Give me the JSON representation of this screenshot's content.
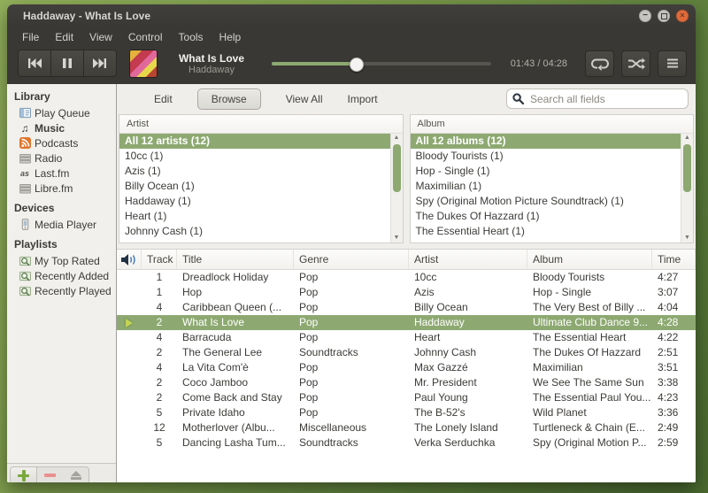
{
  "window": {
    "title": "Haddaway - What Is Love",
    "buttons": [
      {
        "icon": "minimize-icon"
      },
      {
        "icon": "maximize-icon"
      },
      {
        "icon": "close-icon"
      }
    ]
  },
  "menu": {
    "items": [
      "File",
      "Edit",
      "View",
      "Control",
      "Tools",
      "Help"
    ]
  },
  "player": {
    "transport": [
      {
        "icon": "previous-icon"
      },
      {
        "icon": "pause-icon"
      },
      {
        "icon": "next-icon"
      }
    ],
    "track_title": "What Is Love",
    "track_artist": "Haddaway",
    "time": "01:43 / 04:28",
    "progress_percent": 38.5,
    "extra_buttons": [
      {
        "icon": "repeat-icon"
      },
      {
        "icon": "shuffle-icon"
      },
      {
        "icon": "menu-icon"
      }
    ]
  },
  "sidebar": {
    "sections": [
      {
        "label": "Library",
        "items": [
          {
            "label": "Play Queue",
            "icon": "play-queue-icon"
          },
          {
            "label": "Music",
            "icon": "music-note-icon",
            "selected": true
          },
          {
            "label": "Podcasts",
            "icon": "rss-icon"
          },
          {
            "label": "Radio",
            "icon": "stack-icon"
          },
          {
            "label": "Last.fm",
            "icon": "lastfm-icon"
          },
          {
            "label": "Libre.fm",
            "icon": "stack-icon"
          }
        ]
      },
      {
        "label": "Devices",
        "items": [
          {
            "label": "Media Player",
            "icon": "device-icon"
          }
        ]
      },
      {
        "label": "Playlists",
        "items": [
          {
            "label": "My Top Rated",
            "icon": "smart-playlist-icon"
          },
          {
            "label": "Recently Added",
            "icon": "smart-playlist-icon"
          },
          {
            "label": "Recently Played",
            "icon": "smart-playlist-icon"
          }
        ]
      }
    ],
    "footer_buttons": [
      {
        "icon": "add-icon",
        "active": true
      },
      {
        "icon": "remove-icon"
      },
      {
        "icon": "eject-icon"
      }
    ]
  },
  "toolbar": {
    "tabs": [
      "Edit",
      "Browse",
      "View All",
      "Import"
    ],
    "active_tab": "Browse",
    "search_icon": "search-icon",
    "search_placeholder": "Search all fields",
    "search_value": ""
  },
  "browser": {
    "artist": {
      "header": "Artist",
      "selected": "All 12 artists (12)",
      "items": [
        "10cc (1)",
        "Azis (1)",
        "Billy Ocean (1)",
        "Haddaway (1)",
        "Heart (1)",
        "Johnny Cash (1)"
      ]
    },
    "album": {
      "header": "Album",
      "selected": "All 12 albums (12)",
      "items": [
        "Bloody Tourists (1)",
        "Hop - Single (1)",
        "Maximilian (1)",
        "Spy (Original Motion Picture Soundtrack) (1)",
        "The Dukes Of Hazzard (1)",
        "The Essential Heart (1)"
      ]
    }
  },
  "tracklist": {
    "header_icon": "speaker-icon",
    "columns": [
      "Track",
      "Title",
      "Genre",
      "Artist",
      "Album",
      "Time"
    ],
    "rows": [
      {
        "track": "1",
        "title": "Dreadlock Holiday",
        "genre": "Pop",
        "artist": "10cc",
        "album": "Bloody Tourists",
        "time": "4:27"
      },
      {
        "track": "1",
        "title": "Hop",
        "genre": "Pop",
        "artist": "Azis",
        "album": "Hop - Single",
        "time": "3:07"
      },
      {
        "track": "4",
        "title": "Caribbean Queen (...",
        "genre": "Pop",
        "artist": "Billy Ocean",
        "album": "The Very Best of Billy ...",
        "time": "4:04"
      },
      {
        "track": "2",
        "title": "What Is Love",
        "genre": "Pop",
        "artist": "Haddaway",
        "album": "Ultimate Club Dance 9...",
        "time": "4:28",
        "playing": true
      },
      {
        "track": "4",
        "title": "Barracuda",
        "genre": "Pop",
        "artist": "Heart",
        "album": "The Essential Heart",
        "time": "4:22"
      },
      {
        "track": "2",
        "title": "The General Lee",
        "genre": "Soundtracks",
        "artist": "Johnny Cash",
        "album": "The Dukes Of Hazzard",
        "time": "2:51"
      },
      {
        "track": "4",
        "title": "La Vita Com'è",
        "genre": "Pop",
        "artist": "Max Gazzé",
        "album": "Maximilian",
        "time": "3:51"
      },
      {
        "track": "2",
        "title": "Coco Jamboo",
        "genre": "Pop",
        "artist": "Mr. President",
        "album": "We See The Same Sun",
        "time": "3:38"
      },
      {
        "track": "2",
        "title": "Come Back and Stay",
        "genre": "Pop",
        "artist": "Paul Young",
        "album": "The Essential Paul You...",
        "time": "4:23"
      },
      {
        "track": "5",
        "title": "Private Idaho",
        "genre": "Pop",
        "artist": "The B-52's",
        "album": "Wild Planet",
        "time": "3:36"
      },
      {
        "track": "12",
        "title": "Motherlover (Albu...",
        "genre": "Miscellaneous",
        "artist": "The Lonely Island",
        "album": "Turtleneck & Chain (E...",
        "time": "2:49"
      },
      {
        "track": "5",
        "title": "Dancing Lasha Tum...",
        "genre": "Soundtracks",
        "artist": "Verka Serduchka",
        "album": "Spy (Original Motion P...",
        "time": "2:59"
      }
    ]
  },
  "colors": {
    "accent_green": "#8da971",
    "titlebar_bg": "#393834",
    "close_button_orange": "#df6b3c",
    "desktop_green_light": "#93b15c",
    "desktop_green_dark": "#49682f",
    "sidebar_bg": "#f1f0ec",
    "add_button_green": "#79a83c",
    "remove_button_red": "#e88f8f"
  }
}
